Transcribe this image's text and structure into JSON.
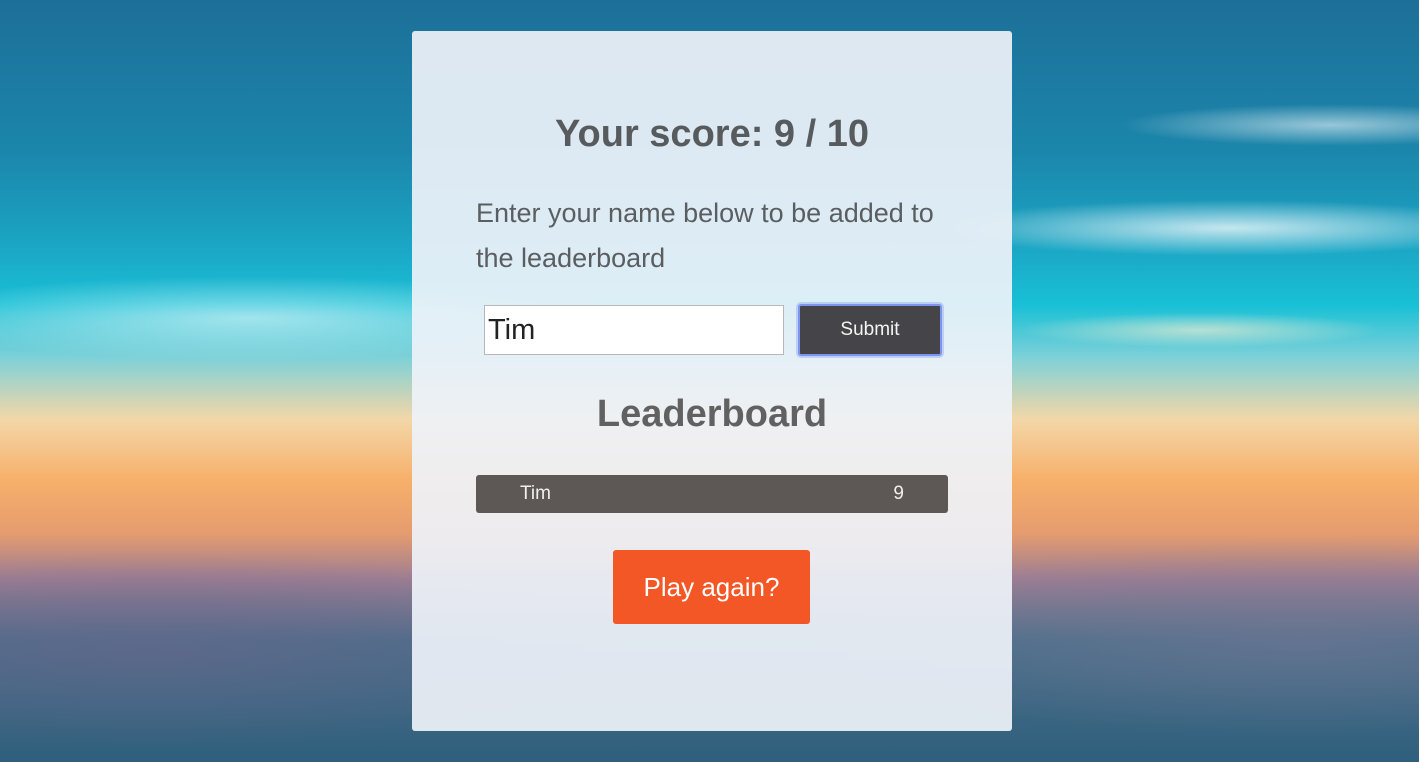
{
  "results": {
    "score_heading": "Your score: 9 / 10",
    "prompt_text": "Enter your name below to be added to the leaderboard"
  },
  "form": {
    "name_value": "Tim",
    "submit_label": "Submit"
  },
  "leaderboard": {
    "title": "Leaderboard",
    "entries": [
      {
        "name": "Tim",
        "score": "9"
      }
    ]
  },
  "actions": {
    "play_again_label": "Play again?"
  },
  "colors": {
    "accent_orange": "#f35726",
    "submit_bg": "#454448",
    "focus_ring": "#7b95f1",
    "row_bg": "#5d5855"
  }
}
